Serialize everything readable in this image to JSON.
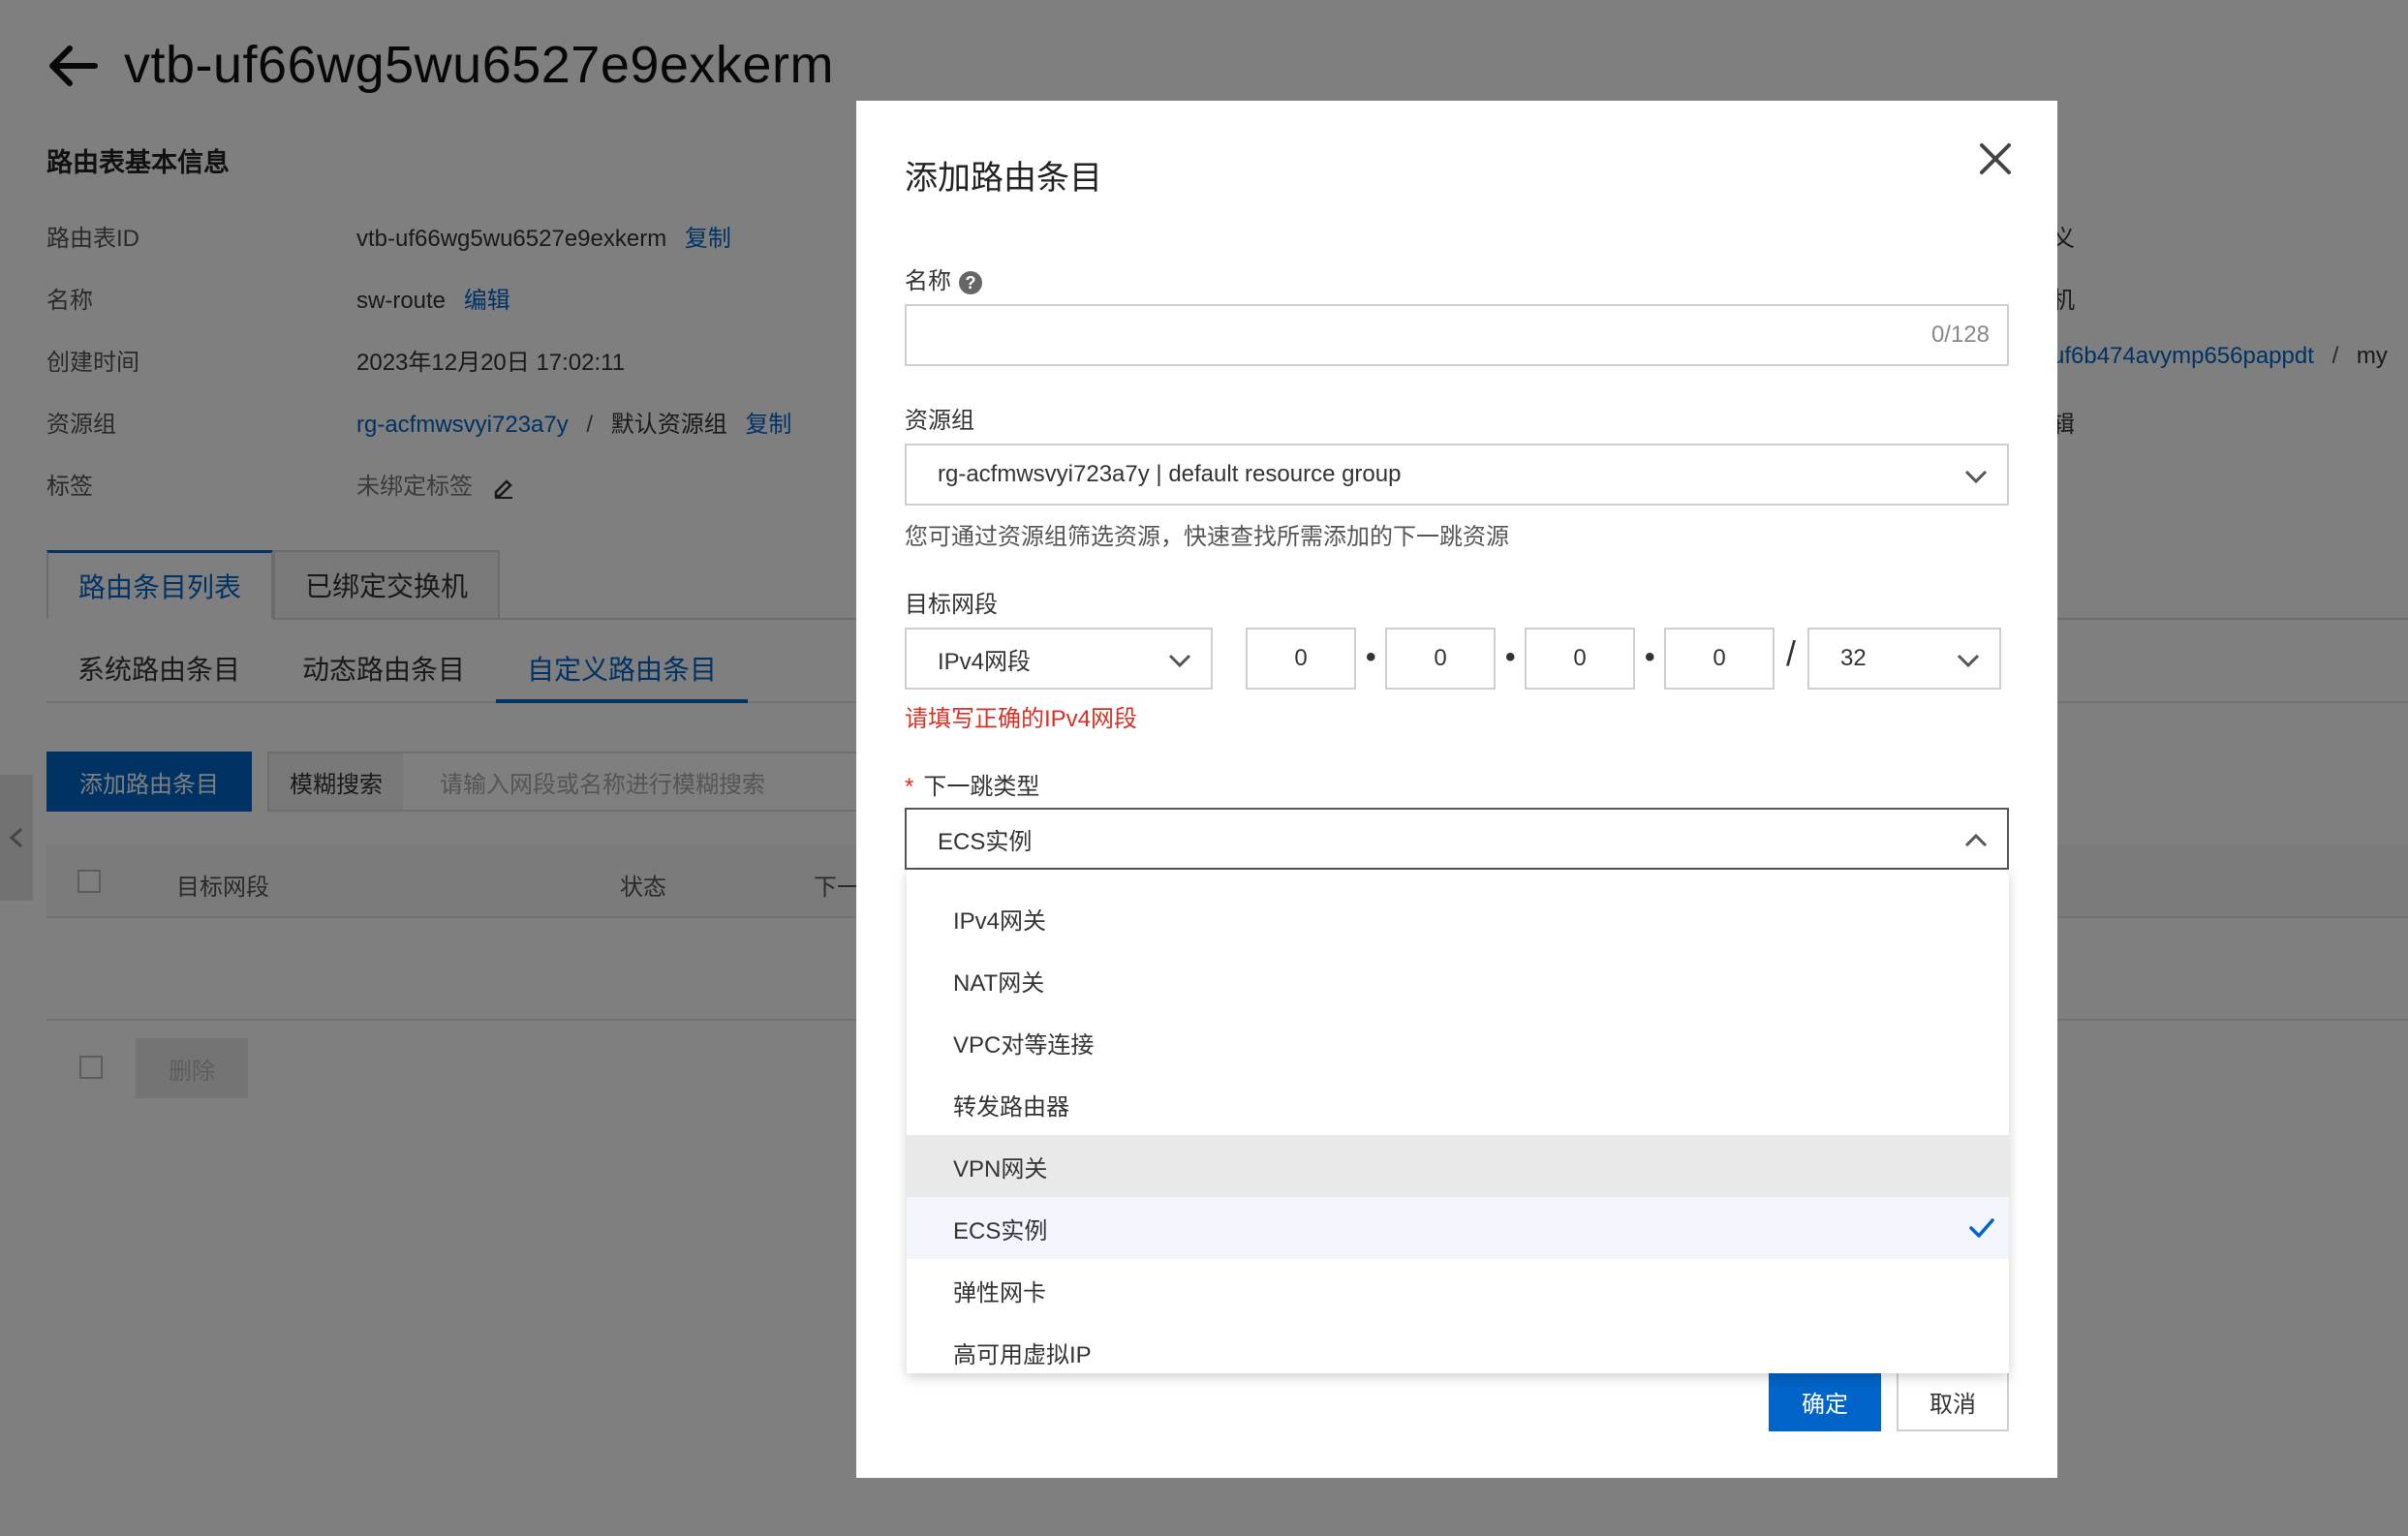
{
  "page": {
    "title": "vtb-uf66wg5wu6527e9exkerm",
    "section_title": "路由表基本信息",
    "info": {
      "route_table_id_label": "路由表ID",
      "route_table_id_value": "vtb-uf66wg5wu6527e9exkerm",
      "copy_label": "复制",
      "name_label": "名称",
      "name_value": "sw-route",
      "edit_label": "编辑",
      "created_label": "创建时间",
      "created_value": "2023年12月20日 17:02:11",
      "resource_group_label": "资源组",
      "resource_group_id": "rg-acfmwsvyi723a7y",
      "resource_group_sep": "/",
      "resource_group_name": "默认资源组",
      "tags_label": "标签",
      "tags_value": "未绑定标签"
    },
    "right_info": {
      "row1": "义",
      "row2": "机",
      "row3_link": "uf6b474avymp656pappdt",
      "row3_sep": "/",
      "row3_text": "my",
      "row4_link": "辑"
    },
    "tabs": [
      "路由条目列表",
      "已绑定交换机"
    ],
    "subtabs": [
      "系统路由条目",
      "动态路由条目",
      "自定义路由条目"
    ],
    "add_button": "添加路由条目",
    "search_mode": "模糊搜索",
    "search_placeholder": "请输入网段或名称进行模糊搜索",
    "table_headers": [
      "目标网段",
      "状态",
      "下一"
    ],
    "delete_button": "删除"
  },
  "dialog": {
    "title": "添加路由条目",
    "name_label": "名称",
    "help_glyph": "?",
    "name_value": "",
    "name_counter": "0/128",
    "resource_group_label": "资源组",
    "resource_group_value": "rg-acfmwsvyi723a7y | default resource group",
    "resource_group_hint": "您可通过资源组筛选资源，快速查找所需添加的下一跳资源",
    "dest_label": "目标网段",
    "ip_type": "IPv4网段",
    "ip_octets": [
      "0",
      "0",
      "0",
      "0"
    ],
    "ip_dot": "•",
    "ip_slash": "/",
    "mask": "32",
    "dest_error": "请填写正确的IPv4网段",
    "required_mark": "*",
    "next_hop_label": "下一跳类型",
    "next_hop_value": "ECS实例",
    "options": [
      "IPv4网关",
      "NAT网关",
      "VPC对等连接",
      "转发路由器",
      "VPN网关",
      "ECS实例",
      "弹性网卡",
      "高可用虚拟IP"
    ],
    "hovered_option": "VPN网关",
    "selected_option": "ECS实例",
    "ok_button": "确定",
    "cancel_button": "取消"
  },
  "colors": {
    "accent": "#0064c8",
    "error": "#d93026",
    "overlay": "rgba(0,0,0,0.5)"
  }
}
